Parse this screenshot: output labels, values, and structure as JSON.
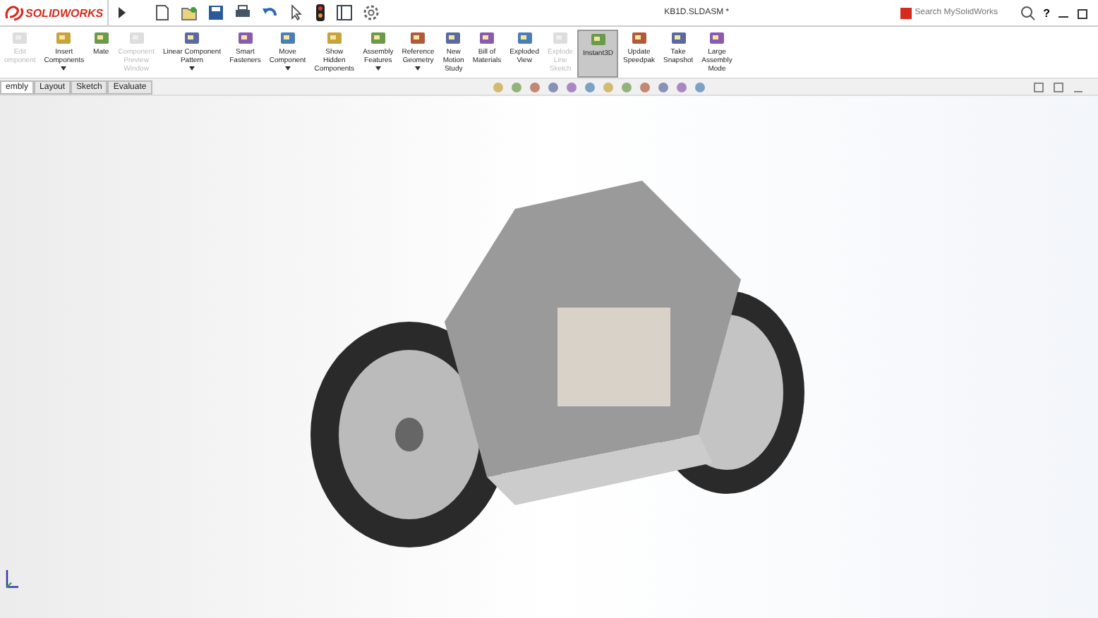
{
  "app": {
    "logo": "SOLIDWORKS",
    "document_title": "KB1D.SLDASM *",
    "search": {
      "placeholder": "Search MySolidWorks"
    },
    "help": "?"
  },
  "ribbon": [
    {
      "lines": [
        "Edit",
        "omponent"
      ],
      "disabled": true,
      "dropdown": false,
      "selected": false
    },
    {
      "lines": [
        "Insert",
        "Components"
      ],
      "disabled": false,
      "dropdown": true,
      "selected": false
    },
    {
      "lines": [
        "Mate"
      ],
      "disabled": false,
      "dropdown": false,
      "selected": false
    },
    {
      "lines": [
        "Component",
        "Preview",
        "Window"
      ],
      "disabled": true,
      "dropdown": false,
      "selected": false
    },
    {
      "lines": [
        "Linear Component",
        "Pattern"
      ],
      "disabled": false,
      "dropdown": true,
      "selected": false
    },
    {
      "lines": [
        "Smart",
        "Fasteners"
      ],
      "disabled": false,
      "dropdown": false,
      "selected": false
    },
    {
      "lines": [
        "Move",
        "Component"
      ],
      "disabled": false,
      "dropdown": true,
      "selected": false
    },
    {
      "lines": [
        "Show",
        "Hidden",
        "Components"
      ],
      "disabled": false,
      "dropdown": false,
      "selected": false
    },
    {
      "lines": [
        "Assembly",
        "Features"
      ],
      "disabled": false,
      "dropdown": true,
      "selected": false
    },
    {
      "lines": [
        "Reference",
        "Geometry"
      ],
      "disabled": false,
      "dropdown": true,
      "selected": false
    },
    {
      "lines": [
        "New",
        "Motion",
        "Study"
      ],
      "disabled": false,
      "dropdown": false,
      "selected": false
    },
    {
      "lines": [
        "Bill of",
        "Materials"
      ],
      "disabled": false,
      "dropdown": false,
      "selected": false
    },
    {
      "lines": [
        "Exploded",
        "View"
      ],
      "disabled": false,
      "dropdown": false,
      "selected": false
    },
    {
      "lines": [
        "Explode",
        "Line",
        "Sketch"
      ],
      "disabled": true,
      "dropdown": false,
      "selected": false
    },
    {
      "lines": [
        "Instant3D"
      ],
      "disabled": false,
      "dropdown": false,
      "selected": true
    },
    {
      "lines": [
        "Update",
        "Speedpak"
      ],
      "disabled": false,
      "dropdown": false,
      "selected": false
    },
    {
      "lines": [
        "Take",
        "Snapshot"
      ],
      "disabled": false,
      "dropdown": false,
      "selected": false
    },
    {
      "lines": [
        "Large",
        "Assembly",
        "Mode"
      ],
      "disabled": false,
      "dropdown": false,
      "selected": false
    }
  ],
  "tabs": [
    {
      "label": "embly",
      "selected": true
    },
    {
      "label": "Layout",
      "selected": false
    },
    {
      "label": "Sketch",
      "selected": false
    },
    {
      "label": "Evaluate",
      "selected": false
    }
  ]
}
